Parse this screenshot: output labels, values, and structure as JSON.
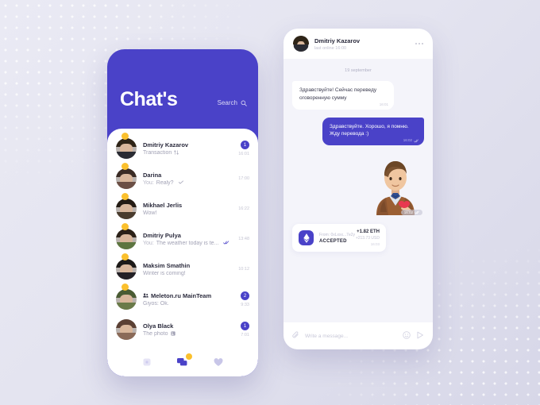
{
  "left_phone": {
    "title": "Chat's",
    "search_label": "Search",
    "search_icon": "search-icon",
    "chats": [
      {
        "name": "Dmitriy Kazarov",
        "message": "Transaction",
        "message_icon": "transfer-arrows-icon",
        "prefix": "",
        "time": "16:01",
        "unread": "1",
        "corner": "gold",
        "group": false,
        "hair": "#2e2417",
        "body": "#2a2b33"
      },
      {
        "name": "Darina",
        "message": "Realy?",
        "prefix": "You:",
        "check": true,
        "time": "17:00",
        "unread": "",
        "corner": "gold",
        "group": false,
        "hair": "#3a2b24",
        "body": "#6b4f45"
      },
      {
        "name": "Mikhael Jerlis",
        "message": "Wow!",
        "prefix": "",
        "time": "16:22",
        "unread": "",
        "corner": "gold",
        "group": false,
        "hair": "#241c14",
        "body": "#4a3c2e"
      },
      {
        "name": "Dmitriy Pulya",
        "message": "The weather today is te...",
        "prefix": "You:",
        "sent_icon": "double-check-icon",
        "time": "13:48",
        "unread": "",
        "corner": "gold",
        "group": false,
        "hair": "#2b2118",
        "body": "#5d7540"
      },
      {
        "name": "Maksim Smathin",
        "message": "Winter is coming!",
        "prefix": "",
        "time": "10:12",
        "unread": "",
        "corner": "gold",
        "group": false,
        "hair": "#1d1a18",
        "body": "#232026"
      },
      {
        "name": "Meleton.ru MainTeam",
        "message": "Giyos: Ok.",
        "prefix": "",
        "time": "9:33",
        "unread": "2",
        "corner": "gold",
        "group": true,
        "group_icon": "group-people-icon",
        "hair": "#4a5b33",
        "body": "#6a7a49"
      },
      {
        "name": "Olya Black",
        "message": "The photo",
        "message_icon": "photo-icon",
        "prefix": "",
        "time": "7:01",
        "unread": "1",
        "corner": "none",
        "group": false,
        "hair": "#5b4034",
        "body": "#8a6a58"
      }
    ],
    "nav": [
      {
        "icon": "stories-square-icon",
        "active": false,
        "badge": ""
      },
      {
        "icon": "chats-bubbles-icon",
        "active": true,
        "badge": "dot"
      },
      {
        "icon": "heart-icon",
        "active": false,
        "badge": ""
      }
    ]
  },
  "right_phone": {
    "header": {
      "name": "Dmitriy Kazarov",
      "status": "last online 16:00",
      "menu_icon": "more-options-icon"
    },
    "day_separator": "19 september",
    "messages": [
      {
        "side": "in",
        "text": "Здравствуйте! Сейчас переведу оговоренную сумму",
        "time": "16:01"
      },
      {
        "side": "out",
        "text": "Здравствуйте. Хорошо, я помню. Жду перевода :)",
        "time": "16:02",
        "status_icon": "double-check-icon"
      }
    ],
    "sticker": {
      "name": "man-with-heart-sticker",
      "time": "16:02",
      "status_icon": "double-check-icon"
    },
    "transaction": {
      "from": "From: 0xLxxx...7e2y",
      "status": "ACCEPTED",
      "amount_eth": "+1.82 ETH",
      "amount_usd": "+213.73 USD",
      "time": "16:03",
      "icon": "ethereum-icon"
    },
    "input": {
      "placeholder": "Write a message...",
      "attach_icon": "attachment-clip-icon",
      "emoji_icon": "emoji-smiley-icon",
      "send_icon": "send-arrow-icon"
    }
  },
  "colors": {
    "brand_purple": "#4a42c8",
    "accent_gold": "#fbc02d",
    "background": "#e2e2ee"
  }
}
